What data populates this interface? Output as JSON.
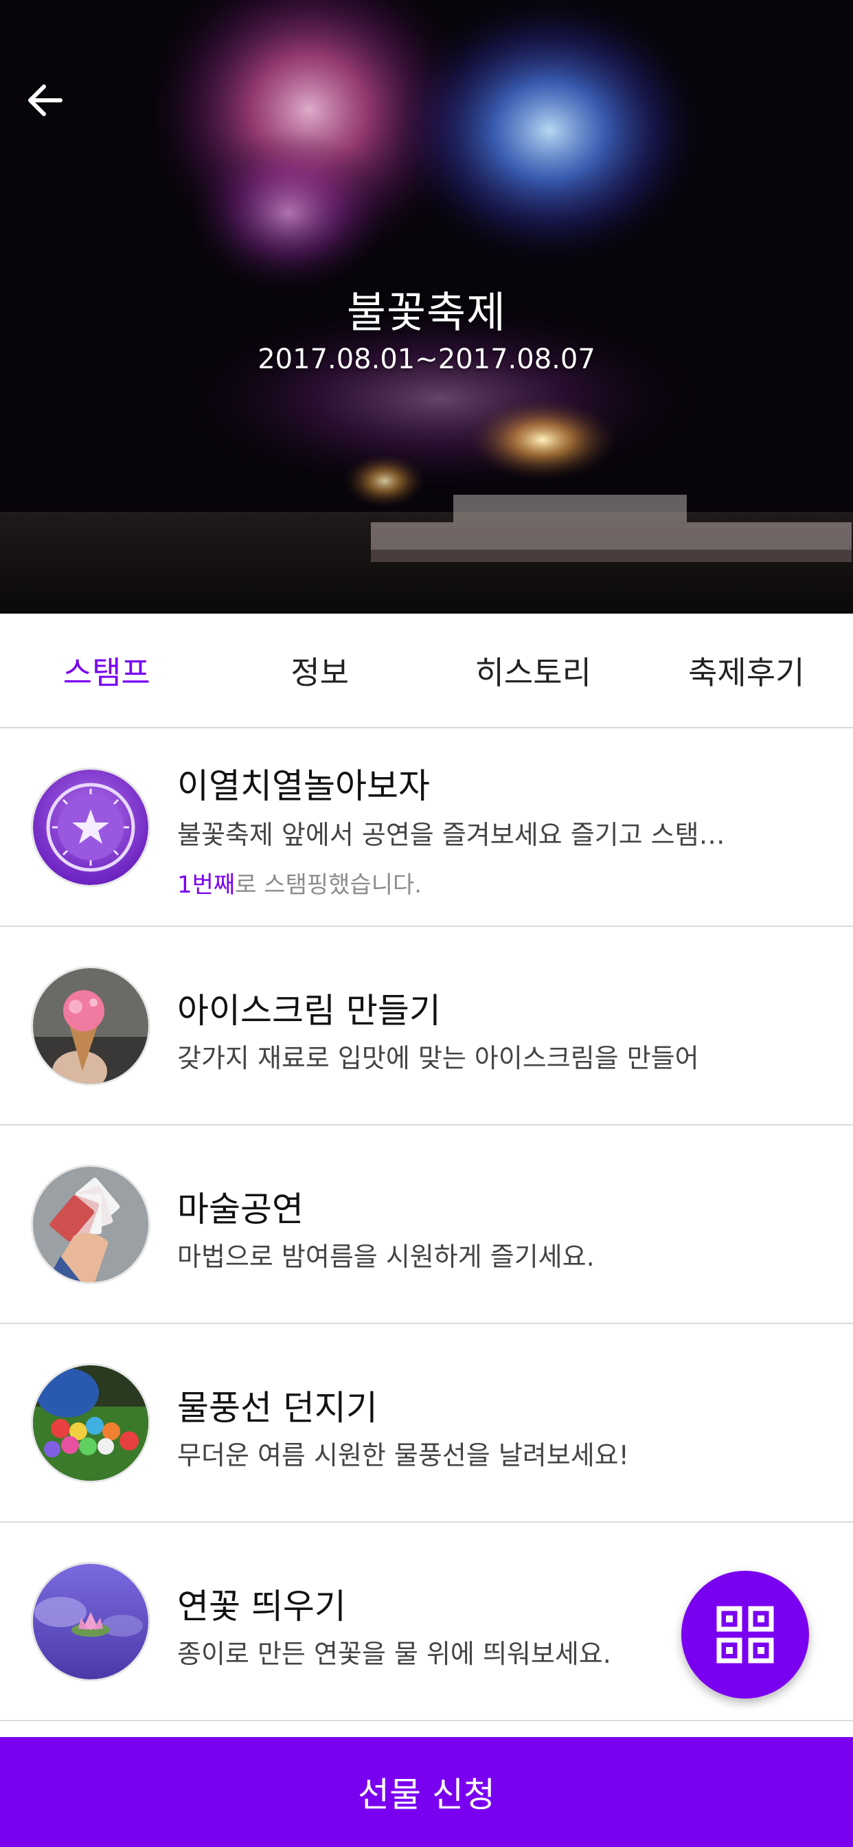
{
  "header": {
    "back_icon": "arrow-left-icon",
    "title": "불꽃축제",
    "dates": "2017.08.01~2017.08.07"
  },
  "tabs": [
    {
      "label": "스탬프",
      "active": true
    },
    {
      "label": "정보",
      "active": false
    },
    {
      "label": "히스토리",
      "active": false
    },
    {
      "label": "축제후기",
      "active": false
    }
  ],
  "events": [
    {
      "title": "이열치열놀아보자",
      "description": "불꽃축제 앞에서 공연을 즐겨보세요 즐기고 스탬…",
      "status_highlight": "1번째",
      "status_text": "로 스탬핑했습니다.",
      "thumb": "stamp-badge-icon"
    },
    {
      "title": "아이스크림 만들기",
      "description": "갖가지 재료로 입맛에 맞는 아이스크림을 만들어",
      "thumb": "ice-cream-photo"
    },
    {
      "title": "마술공연",
      "description": "마법으로 밤여름을 시원하게 즐기세요.",
      "thumb": "playing-cards-photo"
    },
    {
      "title": "물풍선 던지기",
      "description": "무더운 여름 시원한 물풍선을 날려보세요!",
      "thumb": "water-balloons-photo"
    },
    {
      "title": "연꽃 띄우기",
      "description": "종이로 만든 연꽃을 물 위에 띄워보세요.",
      "thumb": "lotus-photo"
    }
  ],
  "fab": {
    "icon": "qr-code-icon"
  },
  "bottom_button": {
    "label": "선물 신청"
  },
  "colors": {
    "accent": "#7a00f0",
    "divider": "#dcdcdc"
  }
}
